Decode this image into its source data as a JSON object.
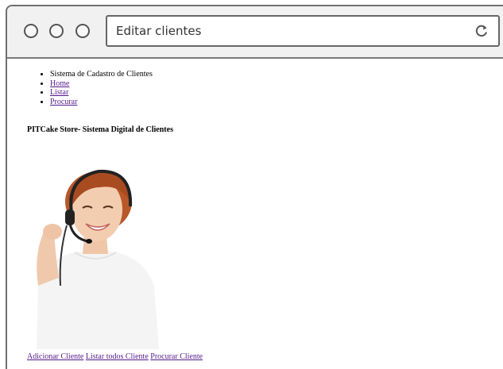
{
  "browser": {
    "address_text": "Editar clientes"
  },
  "nav": {
    "items": [
      {
        "label": "Sistema de Cadastro de Clientes",
        "is_link": false
      },
      {
        "label": "Home",
        "is_link": true
      },
      {
        "label": "Listar",
        "is_link": true
      },
      {
        "label": "Procurar",
        "is_link": true
      }
    ]
  },
  "main": {
    "title": "PITCake Store- Sistema Digital de Clientes"
  },
  "footer": {
    "links": [
      "Adicionar Cliente",
      "Listar todos Cliente",
      "Procurar Cliente"
    ]
  },
  "colors": {
    "link_visited": "#551a8b",
    "chrome_bg": "#f1f1f1"
  }
}
